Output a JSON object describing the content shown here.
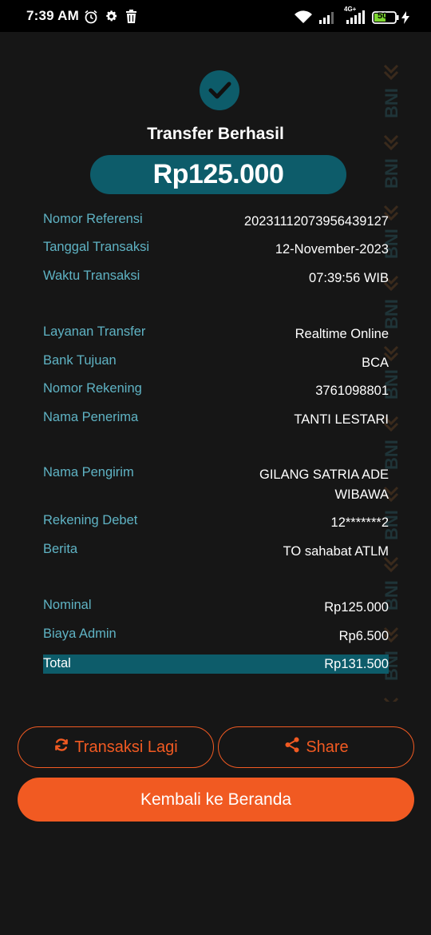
{
  "status_bar": {
    "time": "7:39 AM",
    "network": "4G+",
    "battery": "50",
    "icons": [
      "alarm-icon",
      "gear-icon",
      "trash-icon",
      "wifi-icon",
      "signal-icon",
      "battery-icon",
      "charging-icon"
    ]
  },
  "receipt": {
    "title": "Transfer Berhasil",
    "amount": "Rp125.000",
    "watermark_text": "BNI",
    "sections": {
      "transaction": [
        {
          "label": "Nomor Referensi",
          "value": "20231112073956439127"
        },
        {
          "label": "Tanggal Transaksi",
          "value": "12-November-2023"
        },
        {
          "label": "Waktu Transaksi",
          "value": "07:39:56 WIB"
        }
      ],
      "recipient": [
        {
          "label": "Layanan Transfer",
          "value": "Realtime Online"
        },
        {
          "label": "Bank Tujuan",
          "value": "BCA"
        },
        {
          "label": "Nomor Rekening",
          "value": "3761098801"
        },
        {
          "label": "Nama Penerima",
          "value": "TANTI LESTARI"
        }
      ],
      "sender": [
        {
          "label": "Nama Pengirim",
          "value_line1": "GILANG SATRIA ADE",
          "value_line2": "WIBAWA"
        },
        {
          "label": "Rekening Debet",
          "value": "12*******2"
        },
        {
          "label": "Berita",
          "value": "TO sahabat ATLM"
        }
      ],
      "costs": [
        {
          "label": "Nominal",
          "value": "Rp125.000"
        },
        {
          "label": "Biaya Admin",
          "value": "Rp6.500"
        },
        {
          "label": "Total",
          "value": "Rp131.500"
        }
      ]
    }
  },
  "actions": {
    "again_label": "Transaksi Lagi",
    "share_label": "Share",
    "home_label": "Kembali ke Beranda"
  },
  "colors": {
    "background": "#161616",
    "accent_teal": "#0d5c6a",
    "label_teal": "#5fb3c4",
    "accent_orange": "#f15a22"
  }
}
